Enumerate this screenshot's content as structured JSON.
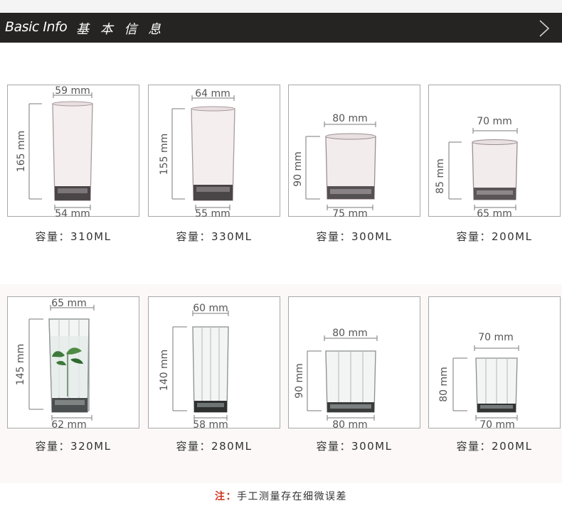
{
  "header": {
    "title_en": "Basic Info",
    "title_cn": "基 本 信 息",
    "icon": "chevron-right-icon"
  },
  "glasses": [
    {
      "top": "59 mm",
      "bottom": "54 mm",
      "height": "165 mm",
      "capacity": "容量：310ML"
    },
    {
      "top": "64 mm",
      "bottom": "55 mm",
      "height": "155 mm",
      "capacity": "容量：330ML"
    },
    {
      "top": "80 mm",
      "bottom": "75 mm",
      "height": "90 mm",
      "capacity": "容量：300ML"
    },
    {
      "top": "70 mm",
      "bottom": "65 mm",
      "height": "85 mm",
      "capacity": "容量：200ML"
    },
    {
      "top": "65 mm",
      "bottom": "62 mm",
      "height": "145 mm",
      "capacity": "容量：320ML"
    },
    {
      "top": "60 mm",
      "bottom": "58 mm",
      "height": "140 mm",
      "capacity": "容量：280ML"
    },
    {
      "top": "80 mm",
      "bottom": "80 mm",
      "height": "90 mm",
      "capacity": "容量：300ML"
    },
    {
      "top": "70 mm",
      "bottom": "70 mm",
      "height": "80 mm",
      "capacity": "容量：200ML"
    }
  ],
  "footnote": {
    "label": "注：",
    "text": "手工测量存在细微误差"
  }
}
